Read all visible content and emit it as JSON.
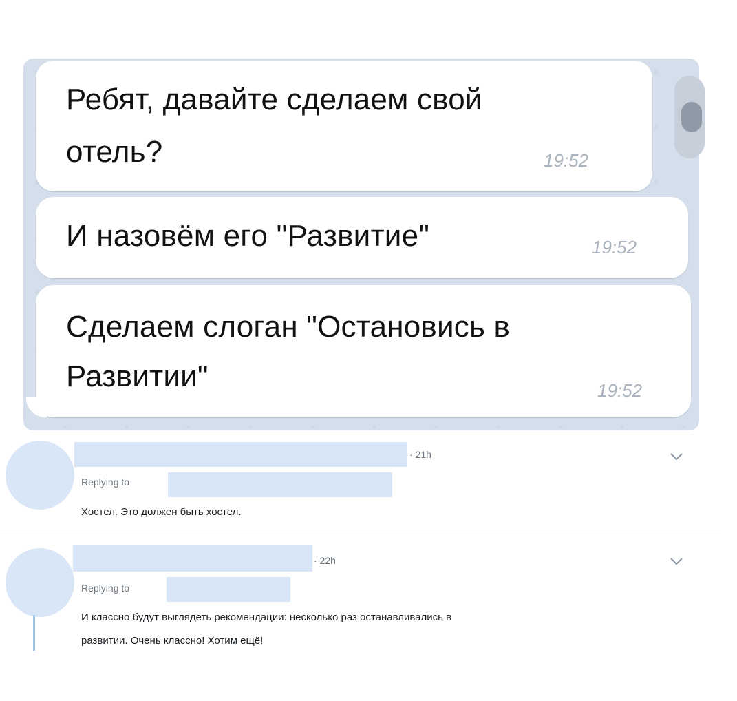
{
  "chat": {
    "messages": [
      {
        "lines": [
          "Ребят, давайте сделаем свой",
          "отель?"
        ],
        "time": "19:52"
      },
      {
        "lines": [
          "И назовём его \"Развитие\""
        ],
        "time": "19:52"
      },
      {
        "lines": [
          "Сделаем слоган \"Остановись в",
          "Развитии\""
        ],
        "time": "19:52"
      }
    ]
  },
  "replies": [
    {
      "time": "· 21h",
      "replying_label": "Replying to",
      "text_lines": [
        "Хостел. Это должен быть хостел."
      ]
    },
    {
      "time": "· 22h",
      "replying_label": "Replying to",
      "text_lines": [
        "И классно будут выглядеть рекомендации: несколько раз останавливались в",
        "развитии. Очень классно! Хотим ещё!"
      ]
    }
  ],
  "colors": {
    "chat_background": "#d5dfeb",
    "bubble": "#ffffff",
    "redaction": "#d9e6f7",
    "thread_line": "#9fc6e8"
  },
  "icons": {
    "reply_menu": "chevron-down-icon"
  }
}
